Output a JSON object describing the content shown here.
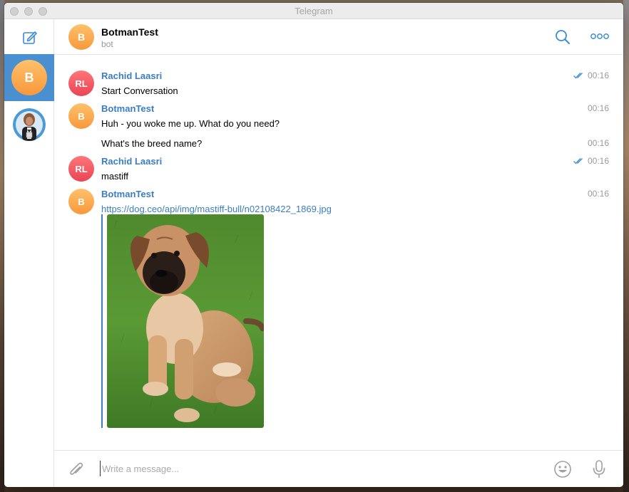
{
  "window": {
    "title": "Telegram"
  },
  "sidebar": {
    "compose_icon": "compose-icon",
    "chats": [
      {
        "avatar_initials": "B",
        "active": true
      },
      {
        "avatar_type": "photo",
        "active": false
      }
    ]
  },
  "header": {
    "avatar_initials": "B",
    "name": "BotmanTest",
    "status": "bot",
    "search_icon": "search-icon",
    "more_icon": "more-icon"
  },
  "messages": [
    {
      "initials": "RL",
      "sender": "Rachid Laasri",
      "text": "Start Conversation",
      "time": "00:16",
      "read": true
    },
    {
      "initials": "B",
      "sender": "BotmanTest",
      "text": "Huh - you woke me up. What do you need?",
      "time": "00:16",
      "read": false
    },
    {
      "text": "What's the breed name?",
      "time": "00:16"
    },
    {
      "initials": "RL",
      "sender": "Rachid Laasri",
      "text": "mastiff",
      "time": "00:16",
      "read": true
    },
    {
      "initials": "B",
      "sender": "BotmanTest",
      "link": "https://dog.ceo/api/img/mastiff-bull/n02108422_1869.jpg",
      "time": "00:16",
      "read": false,
      "image": "mastiff puppy photo"
    }
  ],
  "input": {
    "placeholder": "Write a message...",
    "attach_icon": "paperclip-icon",
    "emoji_icon": "emoji-icon",
    "mic_icon": "microphone-icon"
  },
  "colors": {
    "accent": "#3a7dc3",
    "active_chat": "#4a8fcf",
    "avatar_b": "#f8983b",
    "avatar_rl": "#e94556"
  }
}
